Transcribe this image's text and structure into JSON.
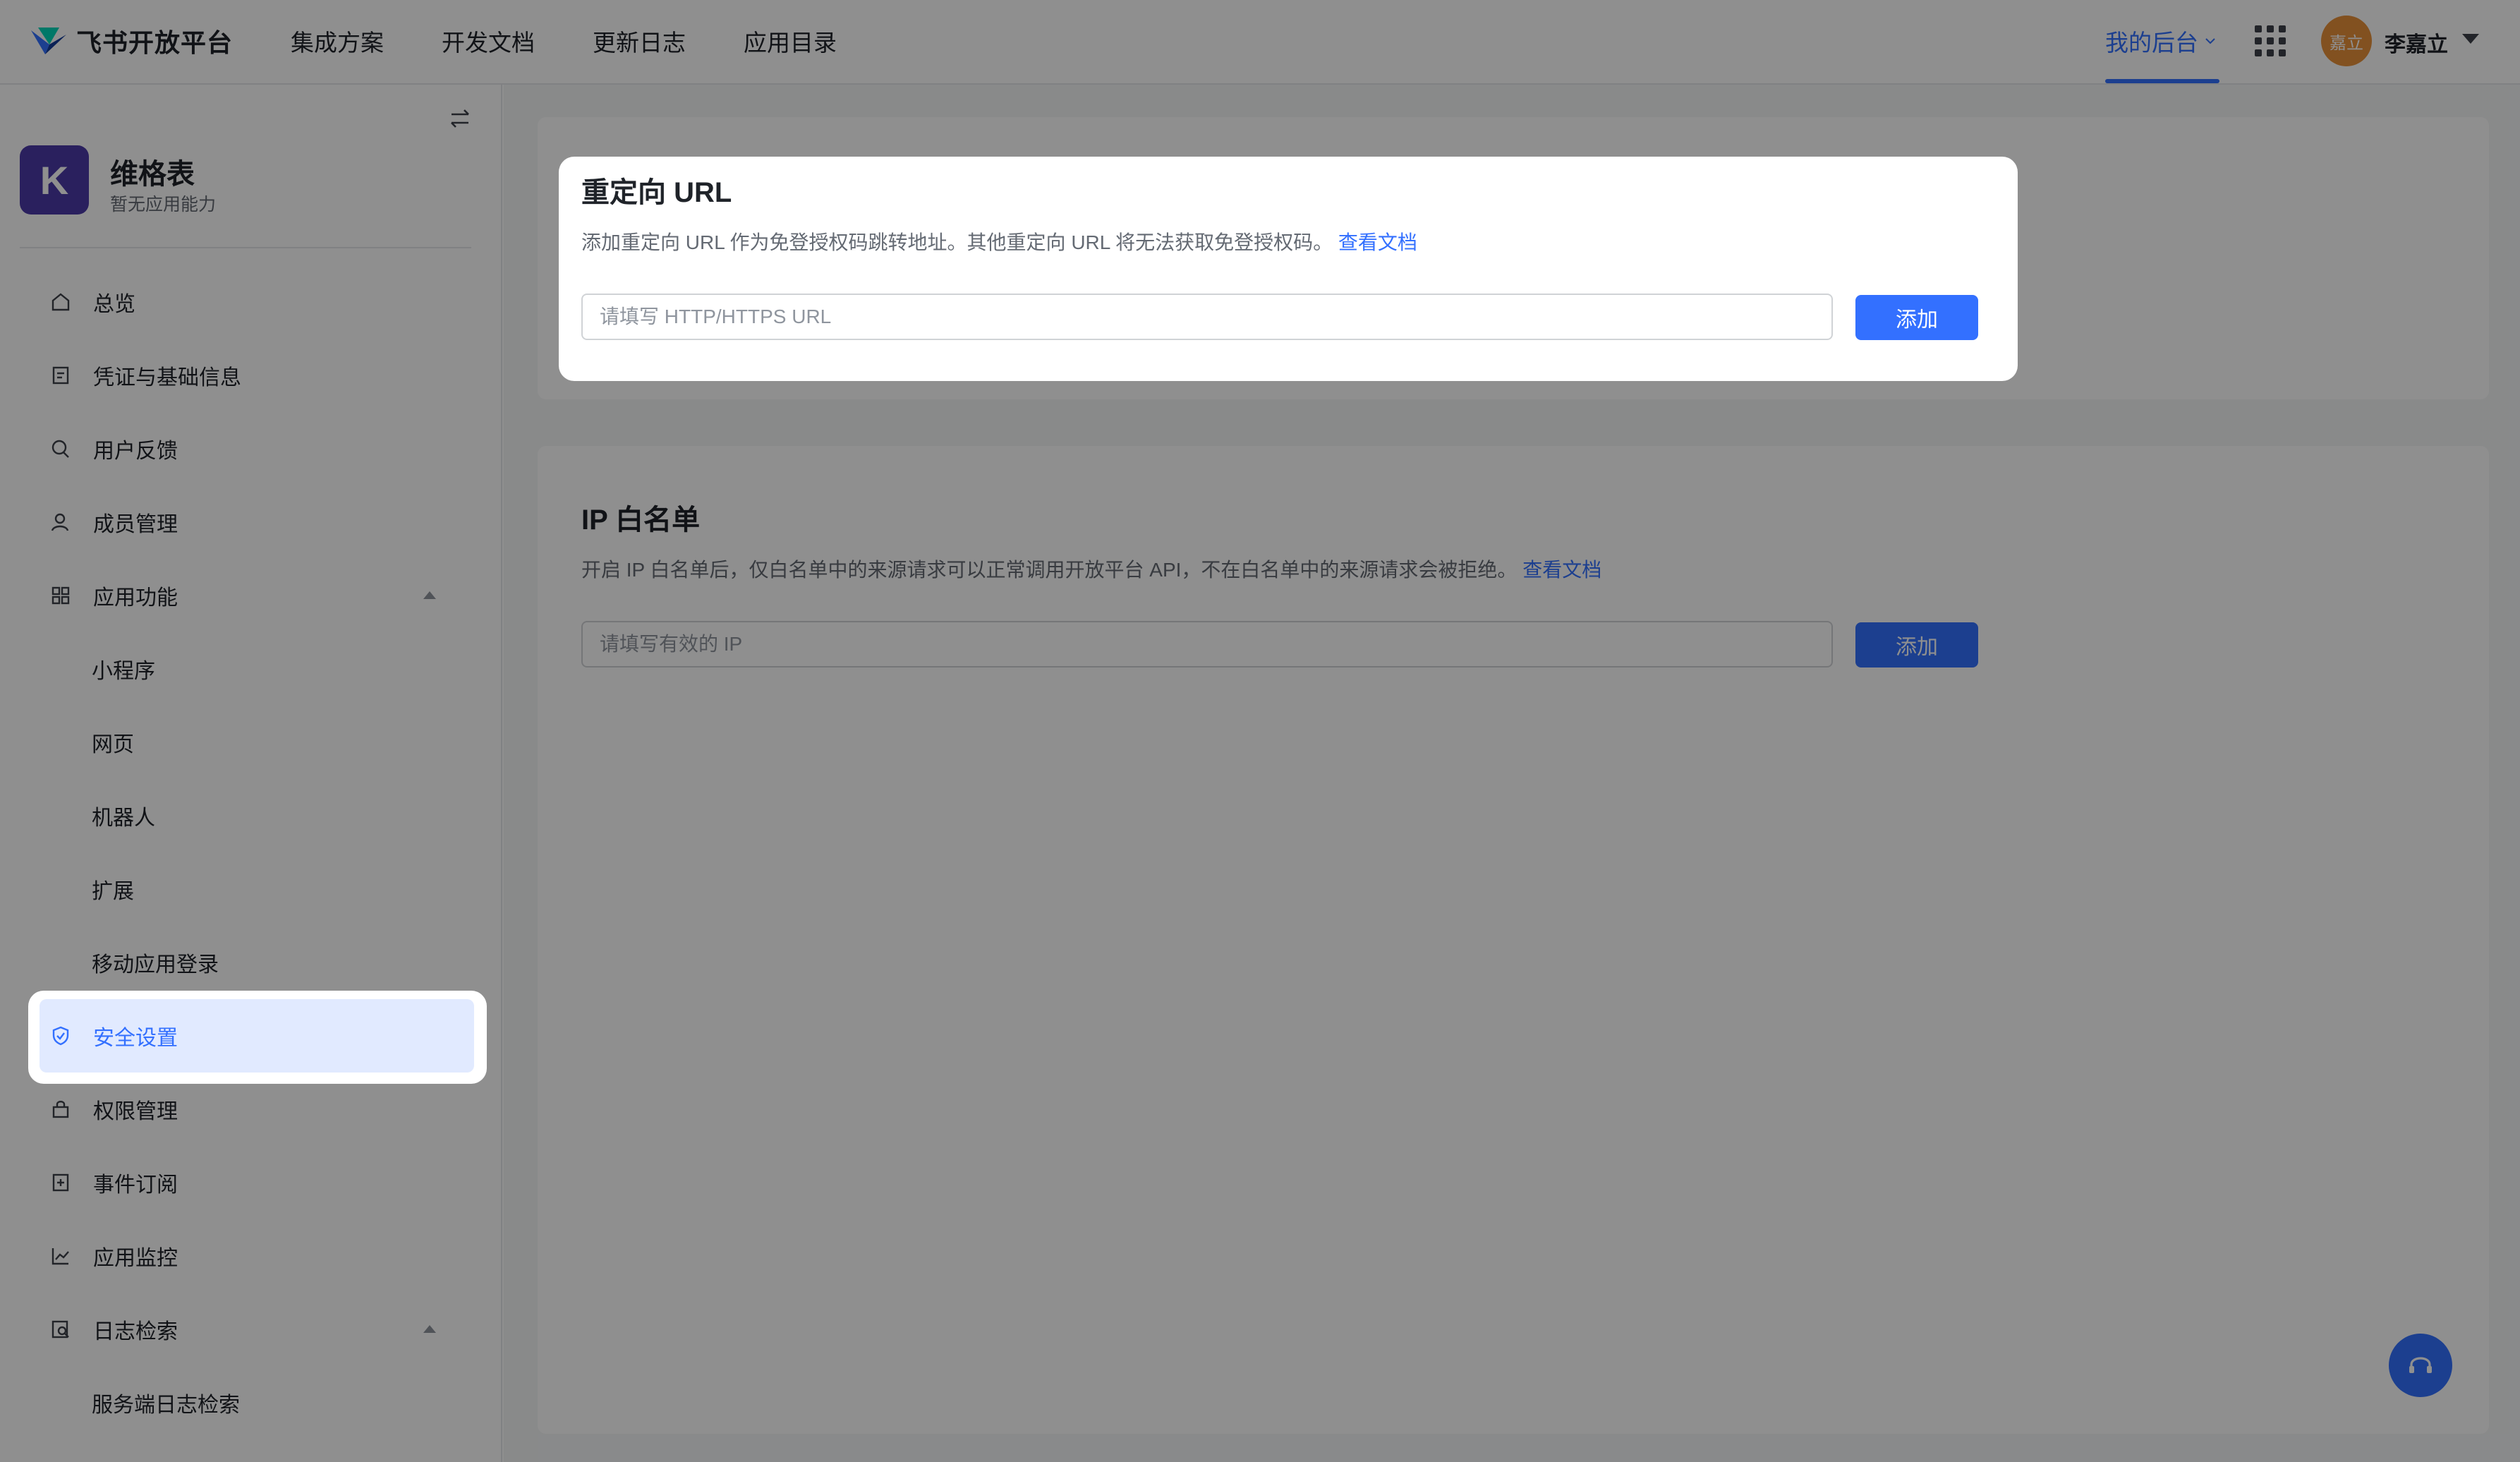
{
  "topnav": {
    "logo_text": "飞书开放平台",
    "links": [
      "集成方案",
      "开发文档",
      "更新日志",
      "应用目录"
    ],
    "my_console": "我的后台",
    "avatar_text": "嘉立",
    "username": "李嘉立"
  },
  "sidebar": {
    "app_logo_letter": "K",
    "app_name": "维格表",
    "app_sub": "暂无应用能力",
    "items": [
      {
        "label": "总览",
        "icon": "home-icon"
      },
      {
        "label": "凭证与基础信息",
        "icon": "credential-icon"
      },
      {
        "label": "用户反馈",
        "icon": "feedback-icon"
      },
      {
        "label": "成员管理",
        "icon": "member-icon"
      },
      {
        "label": "应用功能",
        "icon": "apps-icon",
        "expanded": true
      },
      {
        "label": "小程序",
        "sub": true
      },
      {
        "label": "网页",
        "sub": true
      },
      {
        "label": "机器人",
        "sub": true
      },
      {
        "label": "扩展",
        "sub": true
      },
      {
        "label": "移动应用登录",
        "sub": true
      },
      {
        "label": "安全设置",
        "icon": "shield-icon",
        "active": true
      },
      {
        "label": "权限管理",
        "icon": "lock-icon"
      },
      {
        "label": "事件订阅",
        "icon": "event-icon"
      },
      {
        "label": "应用监控",
        "icon": "chart-icon"
      },
      {
        "label": "日志检索",
        "icon": "log-search-icon",
        "expanded": true
      },
      {
        "label": "服务端日志检索",
        "sub": true
      }
    ]
  },
  "redirect": {
    "title": "重定向 URL",
    "desc": "添加重定向 URL 作为免登授权码跳转地址。其他重定向 URL 将无法获取免登授权码。",
    "doc_link": "查看文档",
    "placeholder": "请填写 HTTP/HTTPS URL",
    "button": "添加"
  },
  "ip_whitelist": {
    "title": "IP 白名单",
    "desc": "开启 IP 白名单后，仅白名单中的来源请求可以正常调用开放平台 API，不在白名单中的来源请求会被拒绝。",
    "doc_link": "查看文档",
    "placeholder": "请填写有效的 IP",
    "button": "添加"
  },
  "colors": {
    "accent": "#3370ff",
    "active_bg": "#e1eaff",
    "app_logo": "#4b3aa8",
    "avatar": "#e8903a"
  }
}
